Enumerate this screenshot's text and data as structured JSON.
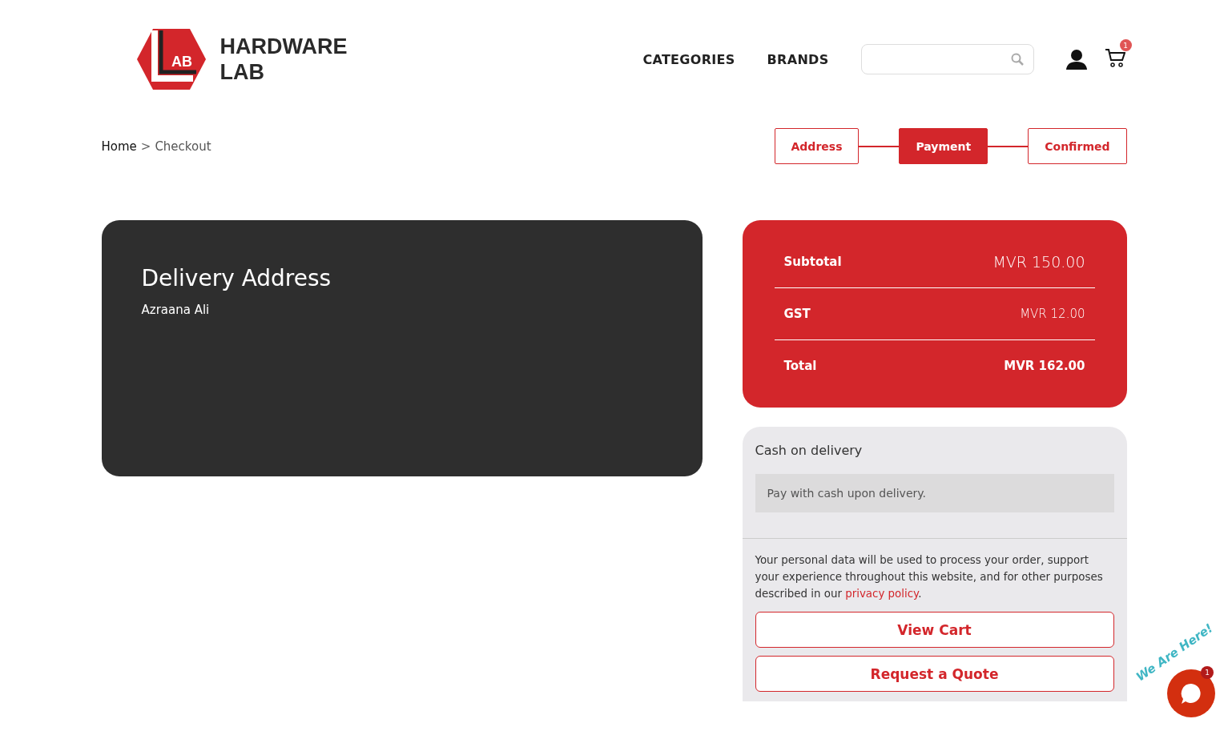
{
  "header": {
    "logo_mark": "AB",
    "brand_lines": [
      "HARDWARE",
      "LAB"
    ],
    "nav": [
      "CATEGORIES",
      "BRANDS"
    ],
    "cart_count": "1"
  },
  "breadcrumb": {
    "home": "Home",
    "separator": ">",
    "current": "Checkout"
  },
  "steps": [
    {
      "label": "Address",
      "selected": false
    },
    {
      "label": "Payment",
      "selected": true
    },
    {
      "label": "Confirmed",
      "selected": false
    }
  ],
  "delivery": {
    "title": "Delivery Address",
    "name": "Azraana Ali"
  },
  "summary": [
    {
      "kind": "subtotal",
      "label": "Subtotal",
      "value": "MVR 150.00"
    },
    {
      "kind": "tax",
      "label": "GST",
      "value": "MVR 12.00"
    },
    {
      "kind": "total",
      "label": "Total",
      "value": "MVR 162.00"
    }
  ],
  "payment": {
    "method": "Cash on delivery",
    "description": "Pay with cash upon delivery.",
    "notice_before": "Your personal data will be used to process your order, support your experience throughout this website, and for other purposes described in our ",
    "notice_link": "privacy policy",
    "notice_after": "."
  },
  "buttons": [
    "View Cart",
    "Request a Quote"
  ],
  "chat": {
    "tagline": "We Are Here!",
    "badge": "1"
  }
}
